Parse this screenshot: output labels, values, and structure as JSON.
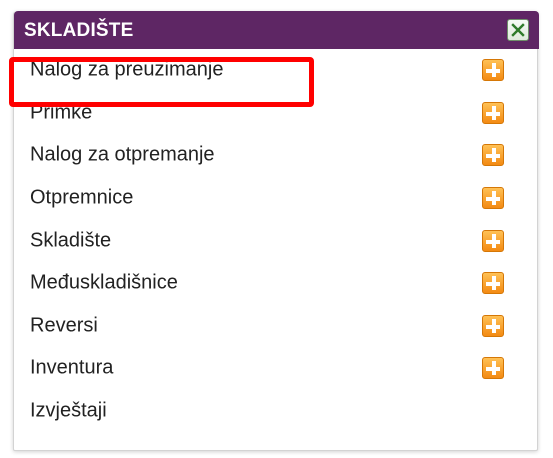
{
  "panel": {
    "title": "SKLADIŠTE",
    "close_icon": "close-x-icon"
  },
  "menu": {
    "add_icon": "plus-icon",
    "items": [
      {
        "label": "Nalog za preuzimanje",
        "has_add": true
      },
      {
        "label": "Primke",
        "has_add": true
      },
      {
        "label": "Nalog za otpremanje",
        "has_add": true
      },
      {
        "label": "Otpremnice",
        "has_add": true
      },
      {
        "label": "Skladište",
        "has_add": true
      },
      {
        "label": "Međuskladišnice",
        "has_add": true
      },
      {
        "label": "Reversi",
        "has_add": true
      },
      {
        "label": "Inventura",
        "has_add": true
      },
      {
        "label": "Izvještaji",
        "has_add": false
      }
    ]
  },
  "colors": {
    "header_bg": "#5e2664",
    "add_icon": "#f38a13",
    "highlight": "#ff0000"
  }
}
